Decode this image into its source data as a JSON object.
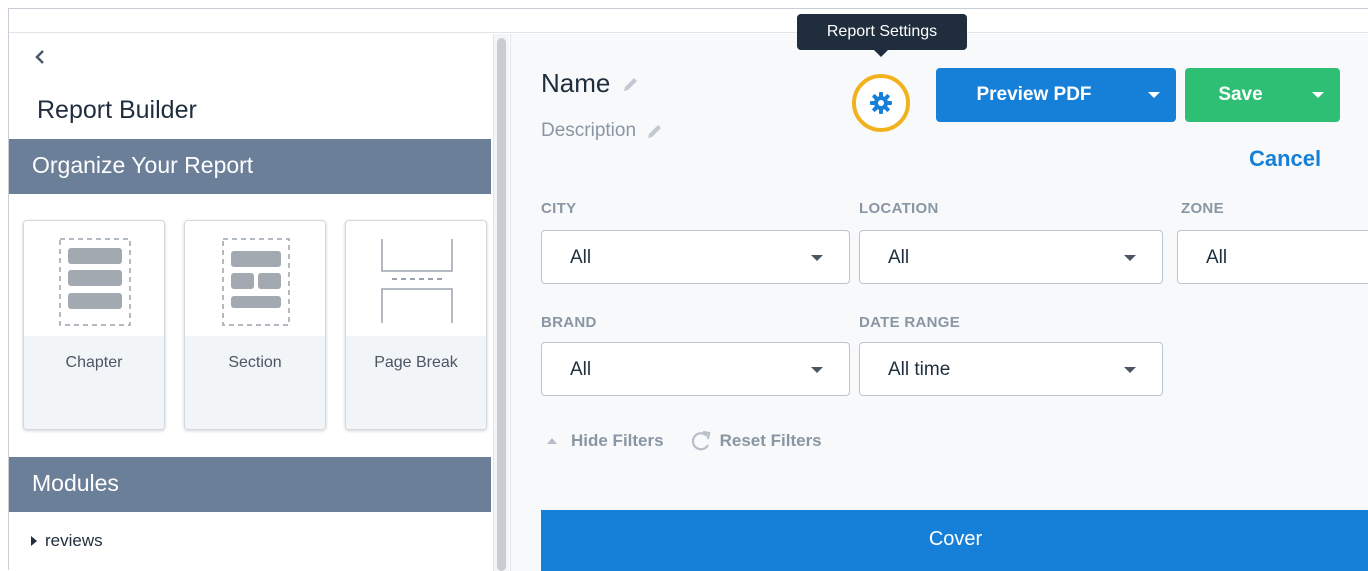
{
  "sidebar": {
    "back_icon": "chevron-left-icon",
    "title": "Report Builder",
    "organize_header": "Organize Your Report",
    "tiles": [
      {
        "label": "Chapter",
        "icon": "chapter-icon"
      },
      {
        "label": "Section",
        "icon": "section-icon"
      },
      {
        "label": "Page Break",
        "icon": "page-break-icon"
      }
    ],
    "modules_header": "Modules",
    "modules": [
      {
        "label": "reviews",
        "icon": "caret-right-icon"
      }
    ]
  },
  "report": {
    "name": "Name",
    "description": "Description",
    "settings_tooltip": "Report Settings",
    "settings_icon": "gear-icon",
    "preview_label": "Preview PDF",
    "save_label": "Save",
    "cancel_label": "Cancel"
  },
  "filters": {
    "city": {
      "label": "CITY",
      "value": "All"
    },
    "location": {
      "label": "LOCATION",
      "value": "All"
    },
    "zone": {
      "label": "ZONE",
      "value": "All"
    },
    "brand": {
      "label": "BRAND",
      "value": "All"
    },
    "date_range": {
      "label": "DATE RANGE",
      "value": "All time"
    },
    "hide_label": "Hide Filters",
    "reset_label": "Reset Filters"
  },
  "content": {
    "cover_label": "Cover"
  },
  "colors": {
    "primary": "#1680d9",
    "success": "#2fbf74",
    "sidebar_header": "#6c7f99",
    "highlight_ring": "#f2b21e",
    "tooltip_bg": "#1f2d3d"
  }
}
